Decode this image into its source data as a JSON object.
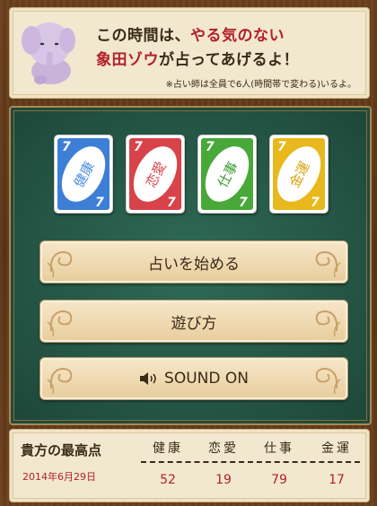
{
  "header": {
    "line1_pre": "この時間は、",
    "line1_red": "やる気のない",
    "line2_red": "象田ゾウ",
    "line2_post": "が占ってあげるよ！",
    "note": "※占い師は全員で6人(時間帯で変わる)いるよ。"
  },
  "cards": [
    {
      "label": "健康",
      "number": "7",
      "color": "#3d7fd6",
      "glyph_color": "#4a8ee0"
    },
    {
      "label": "恋愛",
      "number": "7",
      "color": "#d8434a",
      "glyph_color": "#d8434a"
    },
    {
      "label": "仕事",
      "number": "7",
      "color": "#48a838",
      "glyph_color": "#3e9c33"
    },
    {
      "label": "金運",
      "number": "7",
      "color": "#e8b81c",
      "glyph_color": "#d9a40f"
    }
  ],
  "buttons": {
    "start": "占いを始める",
    "howto": "遊び方",
    "sound": "SOUND ON"
  },
  "score": {
    "title": "貴方の最高点",
    "date": "2014年6月29日",
    "categories": [
      {
        "label": "健康",
        "value": "52"
      },
      {
        "label": "恋愛",
        "value": "19"
      },
      {
        "label": "仕事",
        "value": "79"
      },
      {
        "label": "金運",
        "value": "17"
      }
    ]
  },
  "colors": {
    "accent_red": "#b3202a",
    "felt": "#235243",
    "wood": "#5a3416"
  }
}
